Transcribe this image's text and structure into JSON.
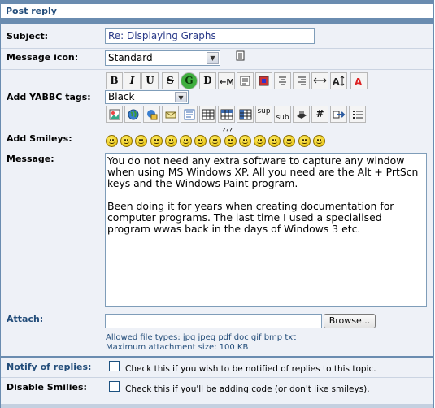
{
  "header": {
    "title": "Post reply"
  },
  "subject": {
    "label": "Subject:",
    "value": "Re: Displaying Graphs"
  },
  "message_icon": {
    "label": "Message icon:",
    "selected": "Standard"
  },
  "yabbc": {
    "label": "Add YABBC tags:",
    "color_selected": "Black",
    "row1": [
      "bold",
      "italic",
      "underline",
      "strikethrough",
      "glow",
      "shadow",
      "move",
      "pre",
      "left",
      "center",
      "right",
      "hr",
      "size",
      "face"
    ],
    "row1_text": {
      "bold": "B",
      "italic": "I",
      "underline": "U",
      "strike": "S",
      "glow": "G",
      "shadow": "D"
    },
    "row2_text": {
      "sup": "sup",
      "sub": "sub",
      "hash": "#"
    }
  },
  "smileys": {
    "label": "Add Smileys:",
    "count": 15,
    "rolleyes_text": "???"
  },
  "message": {
    "label": "Message:",
    "paragraphs": [
      "You do not need any extra software to capture any window when using MS Windows XP. All you need are the Alt + PrtScn keys and the Windows Paint program.",
      "Been doing it for years when creating documentation for computer programs. The last time I used a specialised program wwas back in the days of Windows 3 etc."
    ]
  },
  "attach": {
    "label": "Attach:",
    "browse_label": "Browse...",
    "allowed": "Allowed file types: jpg jpeg pdf doc gif bmp txt",
    "max_size": "Maximum attachment size: 100 KB"
  },
  "notify": {
    "label": "Notify of replies:",
    "text": "Check this if you wish to be notified of replies to this topic."
  },
  "disable_smilies": {
    "label": "Disable Smilies:",
    "text": "Check this if you'll be adding code (or don't like smileys)."
  },
  "colors": {
    "accent": "#6a8cb0",
    "panel": "#eef1f7",
    "label_blue": "#234d7a"
  }
}
